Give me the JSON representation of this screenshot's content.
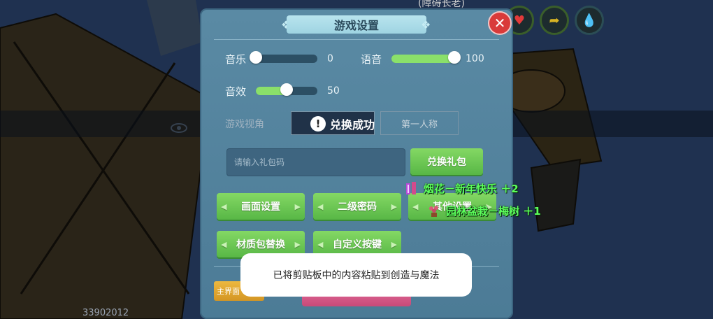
{
  "background": {
    "top_label": "(障碍长老)",
    "player_id": "33902012"
  },
  "status_icons": [
    {
      "name": "heart-icon",
      "glyph": "♥"
    },
    {
      "name": "arrow-icon",
      "glyph": "➦"
    },
    {
      "name": "drop-icon",
      "glyph": "💧"
    }
  ],
  "panel": {
    "title": "游戏设置",
    "close_glyph": "✕"
  },
  "audio": {
    "music_label": "音乐",
    "music_value": "0",
    "music_level": 0,
    "voice_label": "语音",
    "voice_value": "100",
    "voice_level": 100,
    "effects_label": "音效",
    "effects_value": "50",
    "effects_level": 50
  },
  "view": {
    "label": "游戏视角",
    "option_first_person": "第一人称"
  },
  "toast_success": {
    "icon": "!",
    "text": "兑换成功"
  },
  "gift": {
    "input_placeholder": "请输入礼包码",
    "redeem_button": "兑换礼包"
  },
  "buttons": {
    "graphics_settings": "画面设置",
    "secondary_password": "二级密码",
    "other_settings": "其他设置",
    "texture_pack": "材质包替换",
    "custom_keys": "自定义按键",
    "main_screen": "主界面"
  },
  "rewards": [
    {
      "icon": "firework-icon",
      "text": "烟花－新年快乐 ＋2"
    },
    {
      "icon": "bonsai-icon",
      "text": "园林盆栽－梅树 ＋1"
    }
  ],
  "clipboard_toast": "已将剪贴板中的内容粘贴到创造与魔法",
  "colors": {
    "panel": "#5a8aa4",
    "accent_green": "#6ccb52",
    "close_red": "#d93a3a",
    "reward_green": "#5cff5c"
  }
}
